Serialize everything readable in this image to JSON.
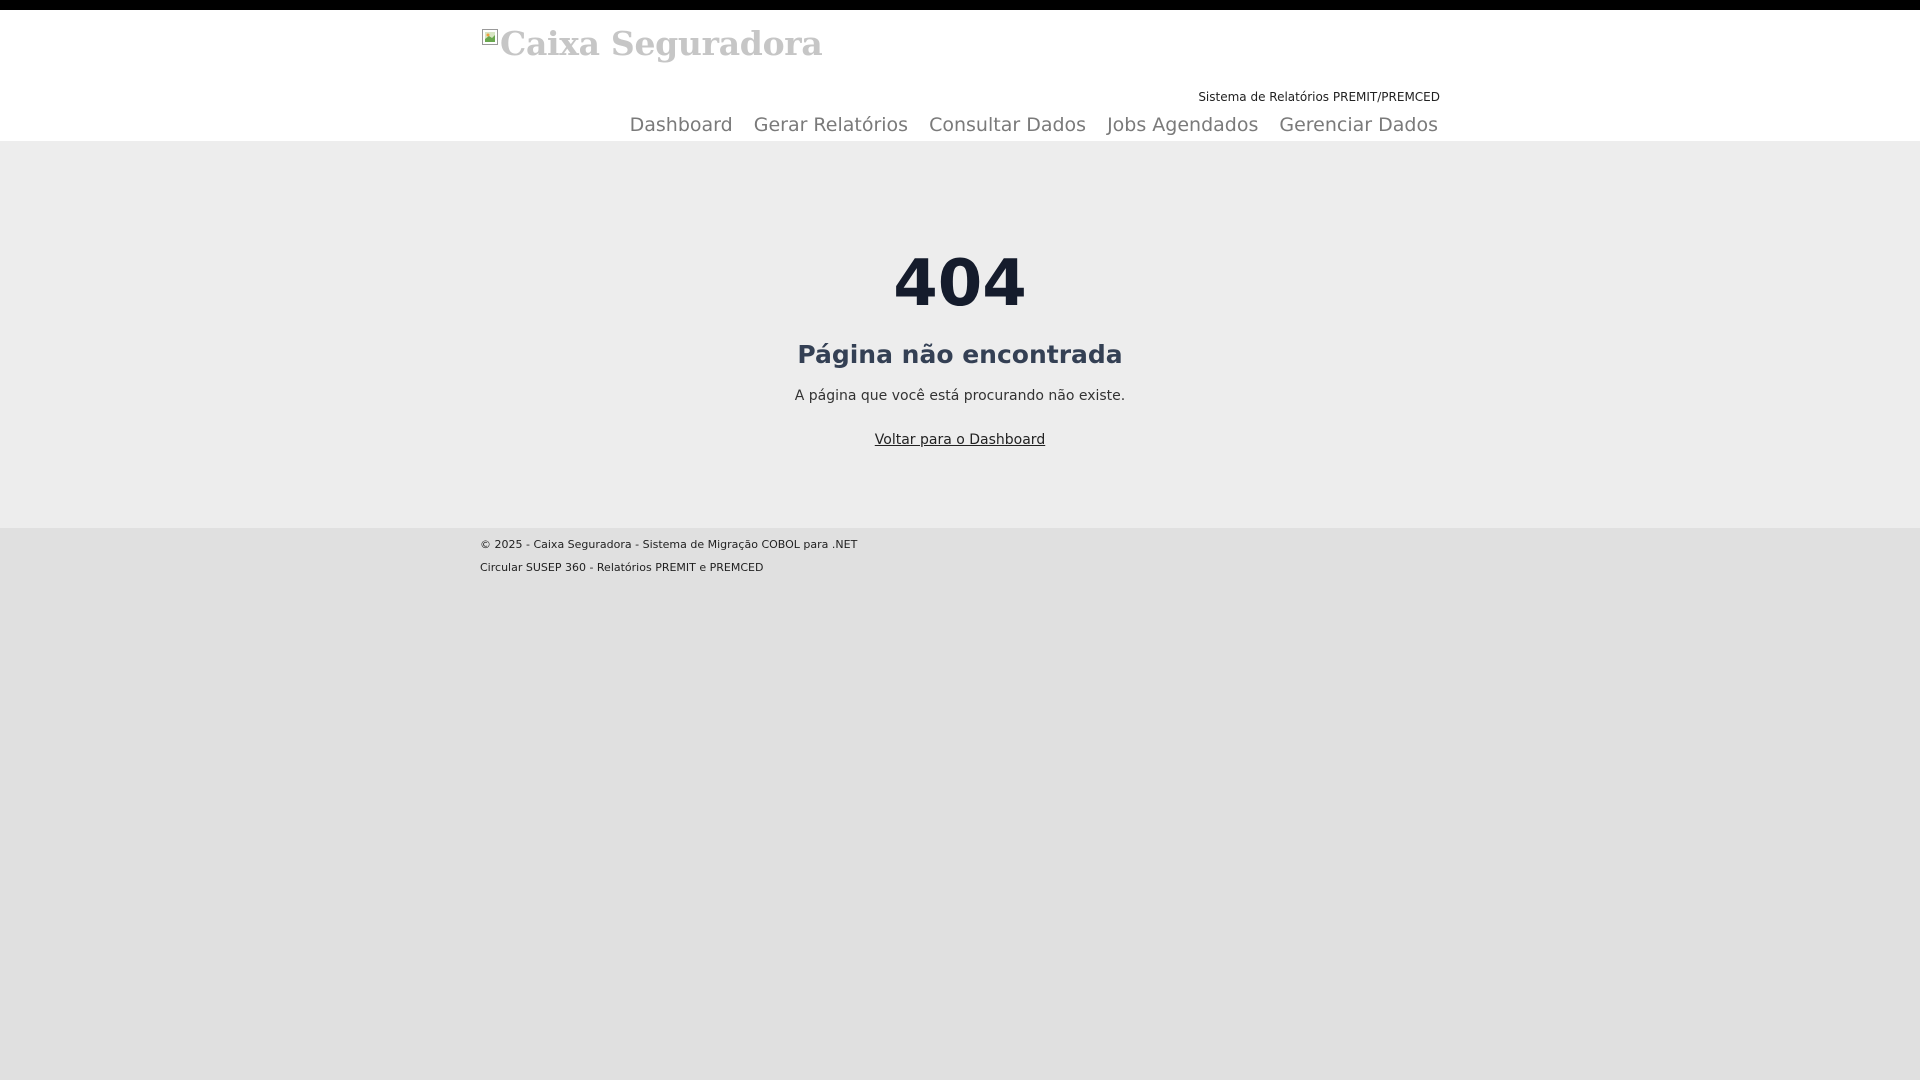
{
  "header": {
    "logo_text": "Caixa Seguradora",
    "subtitle": "Sistema de Relatórios PREMIT/PREMCED",
    "nav": [
      "Dashboard",
      "Gerar Relatórios",
      "Consultar Dados",
      "Jobs Agendados",
      "Gerenciar Dados"
    ]
  },
  "error": {
    "code": "404",
    "title": "Página não encontrada",
    "message": "A página que você está procurando não existe.",
    "link_label": "Voltar para o Dashboard"
  },
  "footer": {
    "line1": "© 2025 - Caixa Seguradora - Sistema de Migração COBOL para .NET",
    "line2": "Circular SUSEP 360 - Relatórios PREMIT e PREMCED"
  },
  "colors": {
    "top_bar": "#000000",
    "header_bg": "#ffffff",
    "main_bg": "#ededed",
    "page_bg": "#e0e0e0",
    "nav_text": "#7a7a7a",
    "error_code": "#151c2c"
  }
}
